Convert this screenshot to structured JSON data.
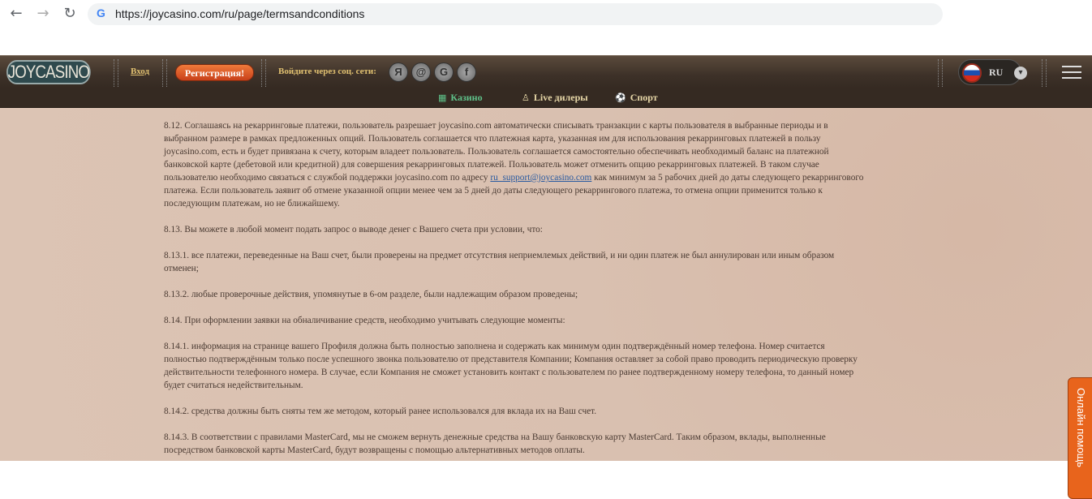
{
  "browser": {
    "url": "https://joycasino.com/ru/page/termsandconditions",
    "back": "←",
    "forward": "→",
    "reload": "↻",
    "g": "G"
  },
  "header": {
    "logo": "JOYCASINO",
    "login": "Вход",
    "register": "Регистрация!",
    "social_label": "Войдите через соц. сети:",
    "social": [
      "Я",
      "@",
      "G",
      "f"
    ],
    "lang": "RU"
  },
  "nav": {
    "tabs": [
      {
        "label": "Казино",
        "icon": "▦"
      },
      {
        "label": "Live дилеры",
        "icon": "♙"
      },
      {
        "label": "Спорт",
        "icon": "⚽"
      }
    ]
  },
  "help": "Онлайн помощь",
  "content": {
    "p0": [
      "8.12. Соглашаясь на рекарринговые платежи, пользователь разрешает joycasino.com автоматически списывать транзакции с карты пользователя в выбранные периоды и в",
      "выбранном размере в рамках предложенных опций. Пользователь соглашается что платежная карта, указанная им для использования рекарринговых платежей в пользу",
      "joycasino.com, есть и будет привязана к счету, которым владеет пользователь. Пользователь соглашается самостоятельно обеспечивать необходимый баланс на платежной",
      "банковской карте (дебетовой или кредитной) для совершения рекарринговых платежей. Пользователь может отменить опцию рекарринговых платежей. В таком случае"
    ],
    "p0_link_pre": "пользователю необходимо связаться с службой поддержки joycasino.com по адресу ",
    "p0_link": "ru_support@joycasino.com",
    "p0_link_post": " как минимум за 5 рабочих дней до даты следующего рекаррингового",
    "p0_rest": [
      "платежа. Если пользователь заявит об отмене указанной опции менее чем за 5 дней до даты следующего рекаррингового платежа, то отмена опции применится только к",
      "последующим платежам, но не ближайшему."
    ],
    "paras": [
      [
        "8.13. Вы можете в любой момент подать запрос о выводе денег с Вашего счета при условии, что:"
      ],
      [
        "8.13.1. все платежи, переведенные на Ваш счет, были проверены на предмет отсутствия неприемлемых действий, и ни один платеж не был аннулирован или иным образом",
        "отменен;"
      ],
      [
        "8.13.2. любые проверочные действия, упомянутые в 6-ом разделе, были надлежащим образом проведены;"
      ],
      [
        "8.14. При оформлении заявки на обналичивание средств, необходимо учитывать следующие моменты:"
      ],
      [
        "8.14.1. информация на странице вашего Профиля должна быть полностью заполнена и содержать как минимум один подтверждённый номер телефона. Номер считается",
        "полностью подтверждённым только после успешного звонка пользователю от представителя Компании; Компания оставляет за собой право проводить периодическую проверку",
        "действительности телефонного номера. В случае, если Компания не сможет установить контакт с пользователем по ранее подтвержденному номеру телефона, то данный номер",
        "будет считаться недействительным."
      ],
      [
        "8.14.2. средства должны быть сняты тем же методом, который ранее использовался для вклада их на Ваш счет."
      ],
      [
        "8.14.3. В соответствии с правилами MasterCard, мы не сможем вернуть денежные средства на Вашу банковскую карту MasterCard. Таким образом, вклады, выполненные",
        "посредством банковской карты MasterCard, будут возвращены с помощью альтернативных методов оплаты."
      ]
    ]
  }
}
